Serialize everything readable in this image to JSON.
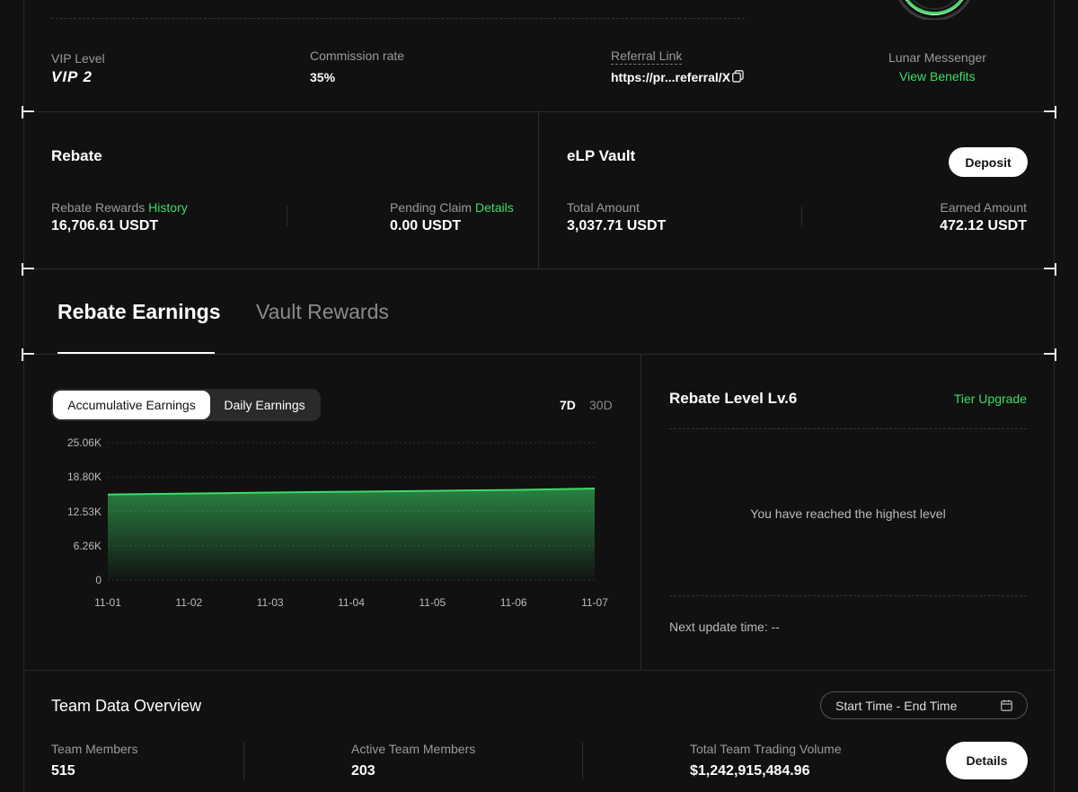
{
  "vip": {
    "label": "VIP Level",
    "value": "VIP 2"
  },
  "commission": {
    "label": "Commission rate",
    "value": "35%"
  },
  "referral": {
    "label": "Referral Link",
    "value": "https://pr...referral/X"
  },
  "messenger": {
    "label": "Lunar Messenger",
    "link": "View Benefits"
  },
  "rebate": {
    "title": "Rebate",
    "rewards_label": "Rebate Rewards",
    "history_link": "History",
    "rewards_value": "16,706.61 USDT",
    "pending_label": "Pending Claim",
    "details_link": "Details",
    "pending_value": "0.00 USDT"
  },
  "vault": {
    "title": "eLP Vault",
    "deposit_label": "Deposit",
    "total_label": "Total Amount",
    "total_value": "3,037.71 USDT",
    "earned_label": "Earned Amount",
    "earned_value": "472.12 USDT"
  },
  "tabs": [
    {
      "label": "Rebate Earnings",
      "active": true
    },
    {
      "label": "Vault Rewards",
      "active": false
    }
  ],
  "earnings": {
    "modes": [
      "Accumulative Earnings",
      "Daily Earnings"
    ],
    "ranges": [
      "7D",
      "30D"
    ],
    "selected_range": "7D"
  },
  "chart_data": {
    "type": "area",
    "x": [
      "11-01",
      "11-02",
      "11-03",
      "11-04",
      "11-05",
      "11-06",
      "11-07"
    ],
    "series": [
      {
        "values": [
          15600,
          15780,
          15960,
          16120,
          16280,
          16450,
          16706.61
        ]
      }
    ],
    "yticks": [
      "0",
      "6.26K",
      "12.53K",
      "18.80K",
      "25.06K"
    ],
    "ylim": [
      0,
      25060
    ],
    "grid": true,
    "color": "#3ddc68"
  },
  "rebate_level": {
    "title": "Rebate Level Lv.6",
    "upgrade_link": "Tier Upgrade",
    "message": "You have reached the highest level",
    "next_update": "Next update time: --"
  },
  "team": {
    "title": "Team Data Overview",
    "date_range": "Start Time - End Time",
    "members_label": "Team Members",
    "members_value": "515",
    "active_label": "Active Team Members",
    "active_value": "203",
    "volume_label": "Total Team Trading Volume",
    "volume_value": "$1,242,915,484.96",
    "details_label": "Details"
  }
}
